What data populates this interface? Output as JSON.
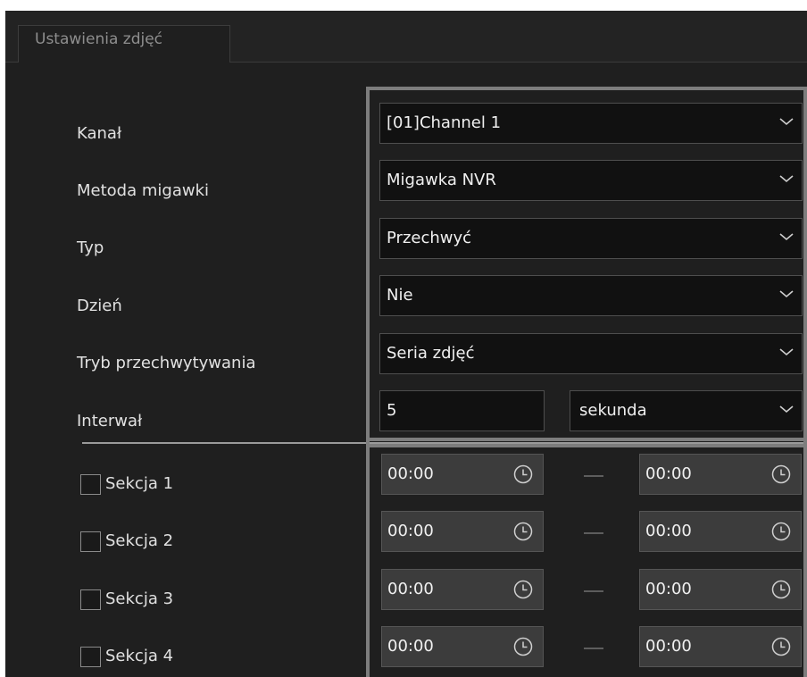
{
  "tab": {
    "label": "Ustawienia zdjęć"
  },
  "rows": [
    {
      "label": "Kanał",
      "value": "[01]Channel 1"
    },
    {
      "label": "Metoda migawki",
      "value": "Migawka NVR"
    },
    {
      "label": "Typ",
      "value": "Przechwyć"
    },
    {
      "label": "Dzień",
      "value": "Nie"
    },
    {
      "label": "Tryb przechwytywania",
      "value": "Seria zdjęć"
    }
  ],
  "interval": {
    "label": "Interwał",
    "value": "5",
    "unit": "sekunda"
  },
  "sections": [
    {
      "label": "Sekcja 1",
      "checked": false,
      "start": "00:00",
      "end": "00:00"
    },
    {
      "label": "Sekcja 2",
      "checked": false,
      "start": "00:00",
      "end": "00:00"
    },
    {
      "label": "Sekcja 3",
      "checked": false,
      "start": "00:00",
      "end": "00:00"
    },
    {
      "label": "Sekcja 4",
      "checked": false,
      "start": "00:00",
      "end": "00:00"
    }
  ],
  "icons": {
    "dropdown": "chevron-down-icon",
    "time": "clock-icon"
  }
}
